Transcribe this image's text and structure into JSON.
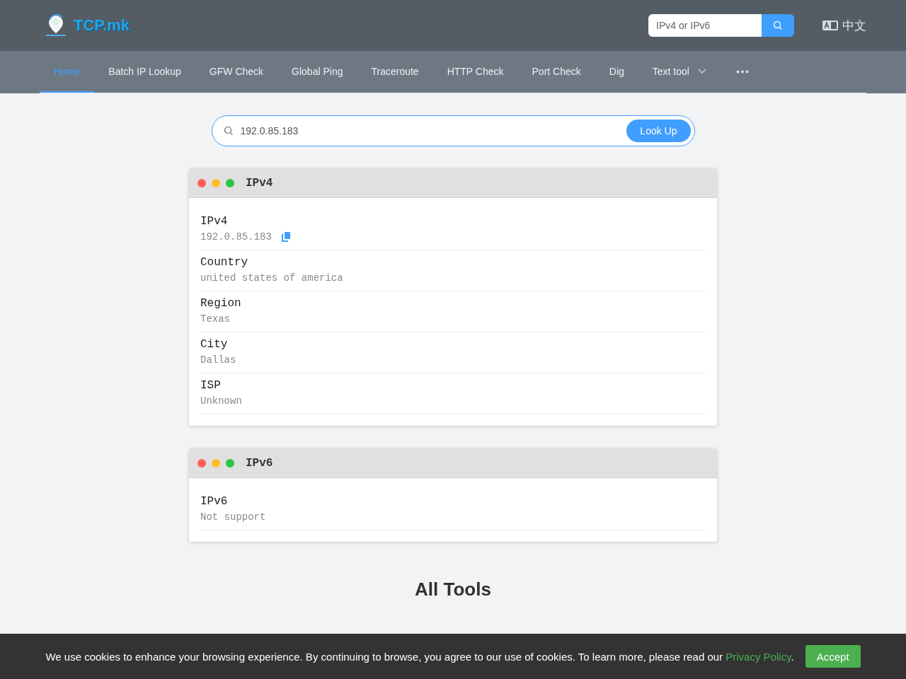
{
  "header": {
    "logo_text": "TCP.mk",
    "search": {
      "placeholder": "IPv4 or IPv6"
    },
    "language": "中文"
  },
  "nav": [
    {
      "label": "Home",
      "selected": true,
      "dropdown": false
    },
    {
      "label": "Batch IP Lookup",
      "selected": false,
      "dropdown": false
    },
    {
      "label": "GFW Check",
      "selected": false,
      "dropdown": false
    },
    {
      "label": "Global Ping",
      "selected": false,
      "dropdown": false
    },
    {
      "label": "Traceroute",
      "selected": false,
      "dropdown": false
    },
    {
      "label": "HTTP Check",
      "selected": false,
      "dropdown": false
    },
    {
      "label": "Port Check",
      "selected": false,
      "dropdown": false
    },
    {
      "label": "Dig",
      "selected": false,
      "dropdown": false
    },
    {
      "label": "Text tool",
      "selected": false,
      "dropdown": true
    }
  ],
  "lookup": {
    "value": "192.0.85.183",
    "button": "Look Up"
  },
  "cards": [
    {
      "title": "IPv4",
      "fields": [
        {
          "label": "IPv4",
          "value": "192.0.85.183",
          "copyable": true
        },
        {
          "label": "Country",
          "value": "united states of america",
          "copyable": false
        },
        {
          "label": "Region",
          "value": "Texas",
          "copyable": false
        },
        {
          "label": "City",
          "value": "Dallas",
          "copyable": false
        },
        {
          "label": "ISP",
          "value": "Unknown",
          "copyable": false
        }
      ]
    },
    {
      "title": "IPv6",
      "fields": [
        {
          "label": "IPv6",
          "value": "Not support",
          "copyable": false
        }
      ]
    }
  ],
  "all_tools_heading": "All Tools",
  "cookie_bar": {
    "text_before": "We use cookies to enhance your browsing experience. By continuing to browse, you agree to our use of cookies. To learn more, please read our ",
    "link": "Privacy Policy",
    "text_after": ".",
    "button": "Accept"
  }
}
